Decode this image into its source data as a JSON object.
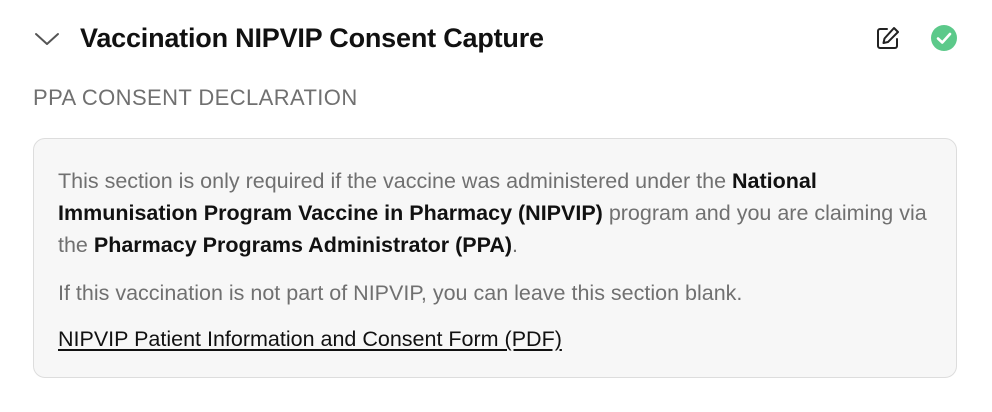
{
  "header": {
    "title": "Vaccination NIPVIP Consent Capture",
    "toggle_icon": "chevron-down-icon",
    "edit_icon": "edit-icon",
    "status_icon": "check-circle-icon",
    "status_color": "#5cc98a"
  },
  "section": {
    "heading": "PPA CONSENT DECLARATION"
  },
  "panel": {
    "intro_part1": "This section is only required if the vaccine was administered under the ",
    "intro_bold1": "National Immunisation Program Vaccine in Pharmacy (NIPVIP)",
    "intro_part2": " program and you are claiming via the ",
    "intro_bold2": "Pharmacy Programs Administrator (PPA)",
    "intro_part3": ".",
    "note": "If this vaccination is not part of NIPVIP, you can leave this section blank.",
    "link_label": "NIPVIP Patient Information and Consent Form (PDF)"
  }
}
